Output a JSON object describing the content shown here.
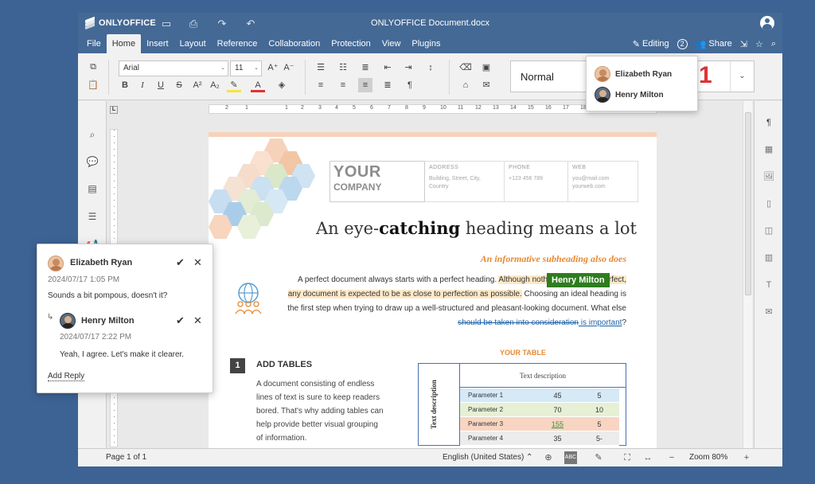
{
  "app": {
    "logo": "ONLYOFFICE",
    "document_title": "ONLYOFFICE Document.docx"
  },
  "menu": {
    "tabs": [
      "File",
      "Home",
      "Insert",
      "Layout",
      "Reference",
      "Collaboration",
      "Protection",
      "View",
      "Plugins"
    ],
    "active_tab": "Home",
    "editing_label": "Editing",
    "coeditors_count": "2",
    "share_label": "Share"
  },
  "toolbar": {
    "font_name": "Arial",
    "font_size": "11",
    "paragraph_style": "Normal",
    "heading_preview": "1"
  },
  "users_popup": {
    "users": [
      "Elizabeth Ryan",
      "Henry Milton"
    ]
  },
  "document": {
    "company_your": "YOUR",
    "company_name": "COMPANY",
    "address_label": "ADDRESS",
    "address_value": "Building, Street, City, Country",
    "phone_label": "PHONE",
    "phone_value": "+123 456 789",
    "web_label": "WEB",
    "web_value_1": "you@mail.com",
    "web_value_2": "yourweb.com",
    "heading_part1": "An eye-",
    "heading_bold": "catching",
    "heading_part2": " heading means a lot",
    "subheading": "An informative subheading also does",
    "para_1": "A perfect document always starts with a perfect heading. ",
    "para_hl": "Although nothing on earth is perfect, any document is expected to be as close to perfection as possible.",
    "para_2": " Choosing an ideal heading is the first step when trying to draw up a well-structured and pleasant-looking document. What else ",
    "para_strike": "should be taken into consideration",
    "para_ins": " is important",
    "para_end": "?",
    "cursor_label": "Henry Milton",
    "section_number": "1",
    "section_title": "ADD TABLES",
    "section_text": "A document consisting of endless lines of text is sure to keep readers bored. That's why adding tables can help provide better visual grouping of information.",
    "table_title": "YOUR TABLE",
    "table_side_label": "Text description",
    "table_header": "Text description",
    "table_rows": [
      {
        "param": "Parameter 1",
        "v1": "45",
        "v2": "5",
        "color": "#d5e9f7"
      },
      {
        "param": "Parameter 2",
        "v1": "70",
        "v2": "10",
        "color": "#e6f0d5"
      },
      {
        "param": "Parameter 3",
        "v1": "155",
        "v2": "5",
        "color": "#f8d5c2"
      },
      {
        "param": "Parameter 4",
        "v1": "35",
        "v2": "5-",
        "color": "#ececec"
      }
    ]
  },
  "comment": {
    "author": "Elizabeth Ryan",
    "date": "2024/07/17 1:05 PM",
    "text": "Sounds a bit pompous, doesn't it?",
    "reply_author": "Henry Milton",
    "reply_date": "2024/07/17 2:22 PM",
    "reply_text": "Yeah, I agree. Let's make it clearer.",
    "add_reply": "Add Reply"
  },
  "status": {
    "page": "Page 1 of 1",
    "language": "English (United States)",
    "zoom": "Zoom 80%"
  },
  "ruler_numbers": [
    "2",
    "1",
    "1",
    "2",
    "3",
    "4",
    "5",
    "6",
    "7",
    "8",
    "9",
    "10",
    "11",
    "12",
    "13",
    "14",
    "15",
    "16",
    "17",
    "18"
  ],
  "colors": {
    "brand": "#446995",
    "background": "#3d6394",
    "accent_orange": "#e88932",
    "cursor_green": "#2e7d1e"
  }
}
